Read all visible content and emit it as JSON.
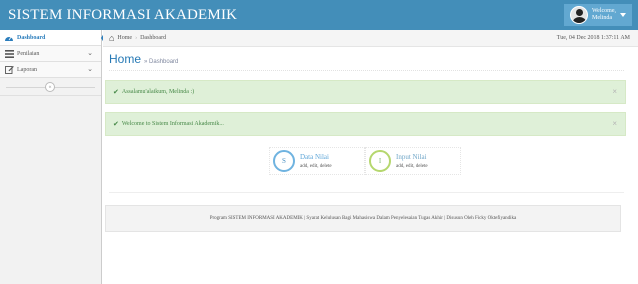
{
  "navbar": {
    "brand": "SISTEM INFORMASI AKADEMIK",
    "user": {
      "greeting": "Welcome,",
      "name": "Melinda"
    }
  },
  "sidebar": {
    "items": [
      {
        "label": "Dashboard",
        "icon": "dashboard-icon",
        "active": true
      },
      {
        "label": "Penilaian",
        "icon": "list-icon",
        "has_submenu": true
      },
      {
        "label": "Laporan",
        "icon": "edit-icon",
        "has_submenu": true
      }
    ],
    "collapse_icon": "double-angle-left-icon"
  },
  "breadcrumbs": {
    "home": "Home",
    "current": "Dashboard",
    "datetime": "Tue, 04 Dec 2018 1:37:11 AM"
  },
  "page": {
    "title": "Home",
    "subtitle": "» Dashboard"
  },
  "alerts": [
    {
      "text": "Assalamu'alaikum, Melinda :)",
      "close": "×"
    },
    {
      "text": "Welcome to Sistem Informasi Akademik...",
      "close": "×"
    }
  ],
  "infoboxes": [
    {
      "icon_letter": "S",
      "title": "Data Nilai",
      "subtitle": "add, edit, delete",
      "color": "#6fb3e0"
    },
    {
      "icon_letter": "I",
      "title": "Input Nilai",
      "subtitle": "add, edit, delete",
      "color": "#b5d76e"
    }
  ],
  "footer": {
    "text": "Program SISTEM INFORMASI AKADEMIK | Syarat Kelulusan Bagi Mahasiswa Dalam Penyelesaian Tugas Akhir | Disusun Oleh Ficky Oktefiyandika"
  },
  "colors": {
    "navbar": "#438eb9",
    "accent": "#2679b5",
    "alert_bg": "#dff0d8",
    "alert_text": "#468847"
  }
}
